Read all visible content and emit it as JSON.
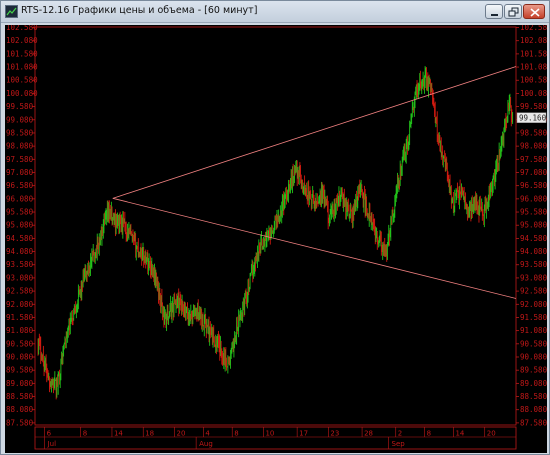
{
  "window": {
    "title": "RTS-12.16 Графики цены и объема - [60 минут]",
    "controls": {
      "minimize": "minimize",
      "maximize": "maximize",
      "close": "close"
    }
  },
  "colors": {
    "background": "#000000",
    "axis": "#c01818",
    "candle_up": "#22c21a",
    "candle_down": "#d21a10",
    "trendline": "#f08080",
    "price_badge": "#e8e8e8"
  },
  "price_label": "99.160",
  "chart_data": {
    "type": "candlestick",
    "ylim": [
      87.5,
      102.6
    ],
    "y_ticks": [
      "102.580",
      "102.080",
      "101.580",
      "101.080",
      "100.580",
      "100.080",
      "99.580",
      "99.080",
      "98.580",
      "98.080",
      "97.580",
      "97.080",
      "96.580",
      "96.080",
      "95.580",
      "95.080",
      "94.580",
      "94.080",
      "93.580",
      "93.080",
      "92.580",
      "92.080",
      "91.580",
      "91.080",
      "90.580",
      "90.080",
      "89.580",
      "89.080",
      "88.580",
      "88.080",
      "87.580"
    ],
    "x_day_labels": [
      "6",
      "8",
      "14",
      "18",
      "20",
      "4",
      "8",
      "10",
      "17",
      "23",
      "28",
      "2",
      "8",
      "14",
      "20"
    ],
    "x_month_labels": [
      "Jul",
      "Aug",
      "Sep"
    ],
    "path": [
      {
        "t": 0,
        "p": 90.7
      },
      {
        "t": 3,
        "p": 89.2
      },
      {
        "t": 5,
        "p": 88.9
      },
      {
        "t": 7,
        "p": 90.5
      },
      {
        "t": 10,
        "p": 92.0
      },
      {
        "t": 13,
        "p": 93.3
      },
      {
        "t": 16,
        "p": 94.3
      },
      {
        "t": 19,
        "p": 95.6
      },
      {
        "t": 20,
        "p": 95.3
      },
      {
        "t": 23,
        "p": 95.1
      },
      {
        "t": 26,
        "p": 94.3
      },
      {
        "t": 29,
        "p": 93.8
      },
      {
        "t": 31,
        "p": 93.3
      },
      {
        "t": 34,
        "p": 91.5
      },
      {
        "t": 37,
        "p": 92.2
      },
      {
        "t": 40,
        "p": 91.6
      },
      {
        "t": 43,
        "p": 91.8
      },
      {
        "t": 46,
        "p": 91.0
      },
      {
        "t": 49,
        "p": 90.3
      },
      {
        "t": 51,
        "p": 89.8
      },
      {
        "t": 53,
        "p": 91.0
      },
      {
        "t": 56,
        "p": 92.6
      },
      {
        "t": 59,
        "p": 94.2
      },
      {
        "t": 62,
        "p": 94.8
      },
      {
        "t": 64,
        "p": 95.3
      },
      {
        "t": 67,
        "p": 96.5
      },
      {
        "t": 69,
        "p": 97.3
      },
      {
        "t": 71,
        "p": 96.5
      },
      {
        "t": 74,
        "p": 95.9
      },
      {
        "t": 76,
        "p": 96.3
      },
      {
        "t": 78,
        "p": 95.3
      },
      {
        "t": 81,
        "p": 96.2
      },
      {
        "t": 84,
        "p": 95.4
      },
      {
        "t": 86,
        "p": 96.5
      },
      {
        "t": 89,
        "p": 95.2
      },
      {
        "t": 91,
        "p": 94.5
      },
      {
        "t": 93,
        "p": 93.9
      },
      {
        "t": 95,
        "p": 95.7
      },
      {
        "t": 97,
        "p": 97.2
      },
      {
        "t": 99,
        "p": 98.3
      },
      {
        "t": 101,
        "p": 100.1
      },
      {
        "t": 103,
        "p": 100.7
      },
      {
        "t": 105,
        "p": 100.3
      },
      {
        "t": 107,
        "p": 98.5
      },
      {
        "t": 109,
        "p": 97.4
      },
      {
        "t": 111,
        "p": 95.9
      },
      {
        "t": 113,
        "p": 96.4
      },
      {
        "t": 115,
        "p": 95.6
      },
      {
        "t": 117,
        "p": 96.0
      },
      {
        "t": 119,
        "p": 95.5
      },
      {
        "t": 121,
        "p": 96.3
      },
      {
        "t": 123,
        "p": 97.4
      },
      {
        "t": 125,
        "p": 99.1
      },
      {
        "t": 126,
        "p": 99.6
      },
      {
        "t": 127,
        "p": 99.16
      }
    ],
    "trendlines": [
      {
        "from": {
          "t": 20,
          "p": 96.1
        },
        "to": {
          "t": 127,
          "p": 101.1
        }
      },
      {
        "from": {
          "t": 20,
          "p": 96.1
        },
        "to": {
          "t": 127,
          "p": 92.3
        }
      }
    ]
  }
}
